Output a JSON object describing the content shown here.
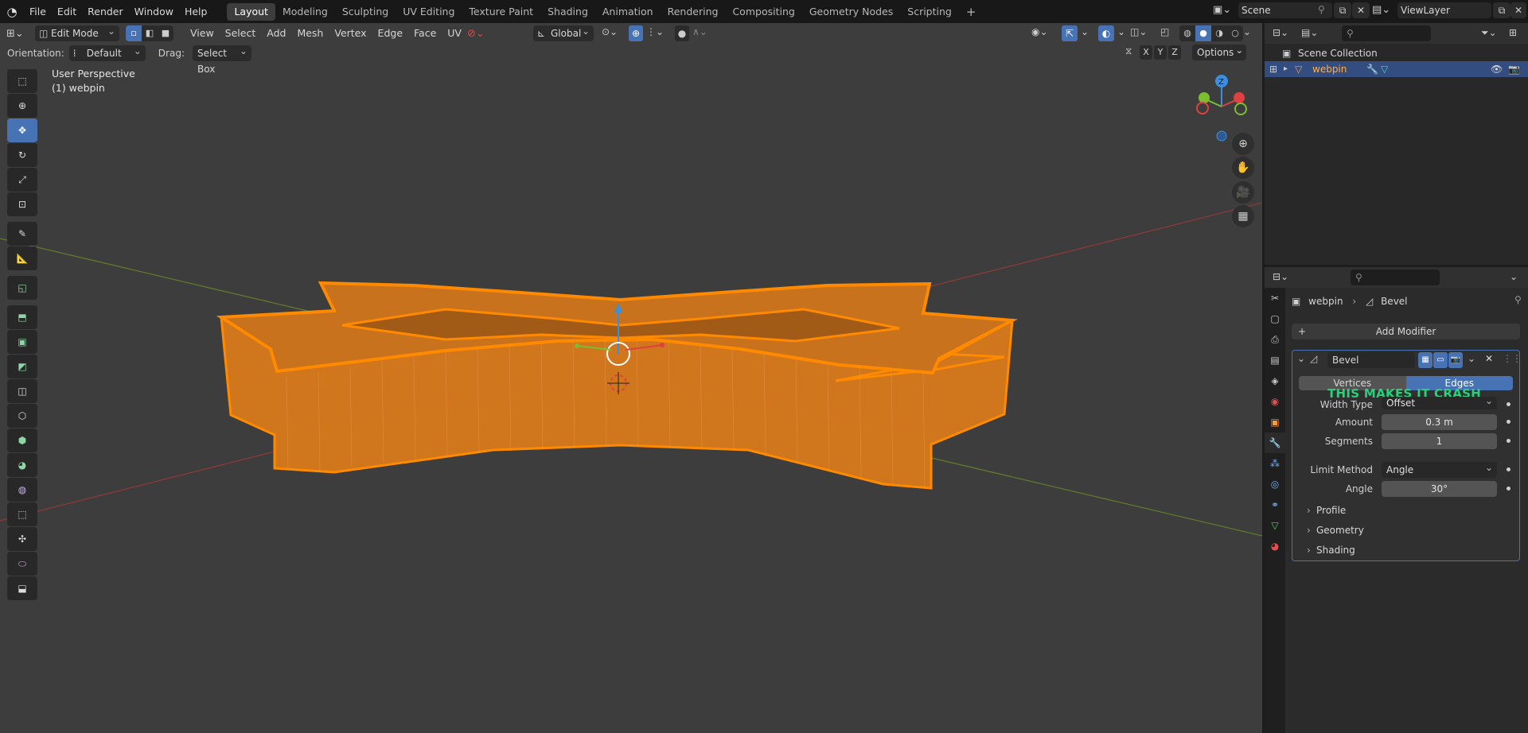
{
  "app": {
    "menu": [
      "File",
      "Edit",
      "Render",
      "Window",
      "Help"
    ],
    "workspaces": [
      "Layout",
      "Modeling",
      "Sculpting",
      "UV Editing",
      "Texture Paint",
      "Shading",
      "Animation",
      "Rendering",
      "Compositing",
      "Geometry Nodes",
      "Scripting"
    ],
    "active_workspace": "Layout",
    "add_workspace": "+",
    "scene": "Scene",
    "view_layer": "ViewLayer"
  },
  "viewport": {
    "mode": "Edit Mode",
    "header_menu": [
      "View",
      "Select",
      "Add",
      "Mesh",
      "Vertex",
      "Edge",
      "Face",
      "UV"
    ],
    "transform_orientation": "Global",
    "orientation_label": "Orientation:",
    "orientation_value": "Default",
    "drag_label": "Drag:",
    "drag_value": "Select Box",
    "axis_x": "X",
    "axis_y": "Y",
    "axis_z": "Z",
    "options": "Options",
    "perspective": "User Perspective",
    "object_info": "(1) webpin",
    "gizmo_z": "Z",
    "colors": {
      "mesh": "#ff8a00",
      "mesh_dark": "#c96d10",
      "x_axis": "#b03c3c",
      "y_axis": "#6a8b2a"
    }
  },
  "outliner": {
    "collection": "Scene Collection",
    "object": "webpin"
  },
  "properties": {
    "breadcrumb_object": "webpin",
    "breadcrumb_modifier": "Bevel",
    "add_modifier": "Add Modifier",
    "modifier": {
      "name": "Bevel",
      "affect_vertices": "Vertices",
      "affect_edges": "Edges",
      "annotation": "THIS MAKES IT CRASH",
      "width_type_label": "Width Type",
      "width_type": "Offset",
      "amount_label": "Amount",
      "amount": "0.3 m",
      "segments_label": "Segments",
      "segments": "1",
      "limit_method_label": "Limit Method",
      "limit_method": "Angle",
      "angle_label": "Angle",
      "angle": "30°",
      "subpanels": [
        "Profile",
        "Geometry",
        "Shading"
      ]
    },
    "colors": {
      "accent": "#4772b3",
      "annotation": "#2bd07a"
    }
  }
}
